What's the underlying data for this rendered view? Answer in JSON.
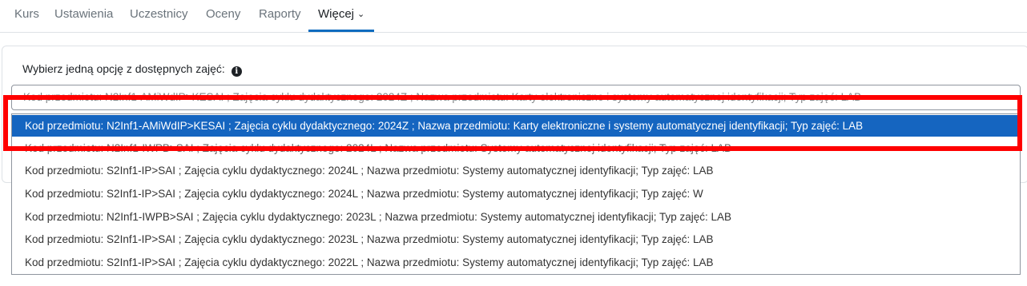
{
  "nav": {
    "items": [
      "Kurs",
      "Ustawienia",
      "Uczestnicy",
      "Oceny",
      "Raporty",
      "Więcej"
    ],
    "active_index": 5
  },
  "form": {
    "label": "Wybierz jedną opcję z dostępnych zajęć:",
    "info_icon": "info-circle-icon",
    "select_value": "Kod przedmiotu: N2Inf1-AMiWdIP>KESAI ; Zajęcia cyklu dydaktycznego: 2024Z ; Nazwa przedmiotu: Karty elektroniczne i systemy automatycznej identyfikacji; Typ zajęć: LAB"
  },
  "options": [
    "Kod przedmiotu: N2Inf1-AMiWdIP>KESAI ; Zajęcia cyklu dydaktycznego: 2024Z ; Nazwa przedmiotu: Karty elektroniczne i systemy automatycznej identyfikacji; Typ zajęć: LAB",
    "Kod przedmiotu: N2Inf1-IWPB>SAI ; Zajęcia cyklu dydaktycznego: 2024L ; Nazwa przedmiotu: Systemy automatycznej identyfikacji; Typ zajęć: LAB",
    "Kod przedmiotu: S2Inf1-IP>SAI ; Zajęcia cyklu dydaktycznego: 2024L ; Nazwa przedmiotu: Systemy automatycznej identyfikacji; Typ zajęć: LAB",
    "Kod przedmiotu: S2Inf1-IP>SAI ; Zajęcia cyklu dydaktycznego: 2024L ; Nazwa przedmiotu: Systemy automatycznej identyfikacji; Typ zajęć: W",
    "Kod przedmiotu: N2Inf1-IWPB>SAI ; Zajęcia cyklu dydaktycznego: 2023L ; Nazwa przedmiotu: Systemy automatycznej identyfikacji; Typ zajęć: LAB",
    "Kod przedmiotu: S2Inf1-IP>SAI ; Zajęcia cyklu dydaktycznego: 2023L ; Nazwa przedmiotu: Systemy automatycznej identyfikacji; Typ zajęć: LAB",
    "Kod przedmiotu: S2Inf1-IP>SAI ; Zajęcia cyklu dydaktycznego: 2022L ; Nazwa przedmiotu: Systemy automatycznej identyfikacji; Typ zajęć: LAB"
  ],
  "selected_option_index": 0,
  "colors": {
    "accent": "#0f6cbf",
    "selected_bg": "#1565c0",
    "highlight": "#ff0000"
  }
}
